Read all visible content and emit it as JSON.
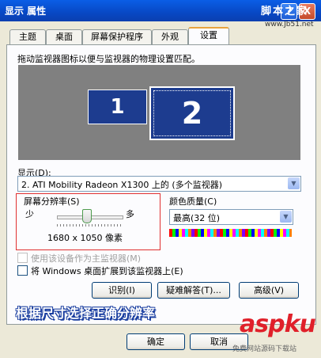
{
  "window": {
    "title": "显示 属性",
    "help": "?",
    "close": "X"
  },
  "watermark_top": {
    "chars": "脚本之家",
    "site": "www.Jb51.net"
  },
  "tabs": [
    {
      "label": "主题"
    },
    {
      "label": "桌面"
    },
    {
      "label": "屏幕保护程序"
    },
    {
      "label": "外观"
    },
    {
      "label": "设置"
    }
  ],
  "instruction": "拖动监视器图标以便与监视器的物理设置匹配。",
  "monitors": {
    "m1": "1",
    "m2": "2"
  },
  "display": {
    "label": "显示(D):",
    "value": "2. ATI Mobility Radeon X1300 上的 (多个监视器)"
  },
  "resolution": {
    "label": "屏幕分辨率(S)",
    "low": "少",
    "high": "多",
    "value": "1680 x 1050 像素",
    "slider_level": 0.45
  },
  "color_quality": {
    "label": "颜色质量(C)",
    "value": "最高(32 位)"
  },
  "checks": [
    {
      "label": "使用该设备作为主监视器(M)",
      "disabled": true
    },
    {
      "label": "将 Windows 桌面扩展到该监视器上(E)",
      "disabled": false
    }
  ],
  "buttons": {
    "identify": "识别(I)",
    "troubleshoot": "疑难解答(T)...",
    "advanced": "高级(V)",
    "ok": "确定",
    "cancel": "取消"
  },
  "overlay_caption": "根据尺寸选择正确分辨率",
  "watermark_bottom": {
    "brand": "aspku",
    "sub": "免费网站源码下载站"
  }
}
